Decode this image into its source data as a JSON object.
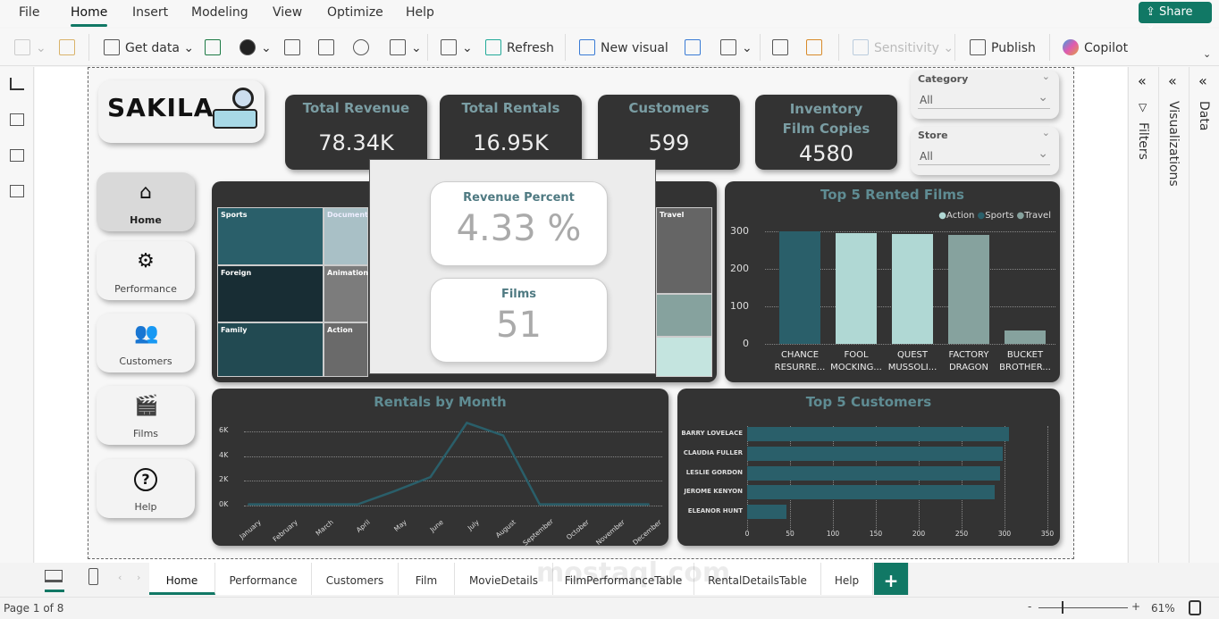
{
  "menu": [
    "File",
    "Home",
    "Insert",
    "Modeling",
    "View",
    "Optimize",
    "Help"
  ],
  "share_label": "Share",
  "ribbon": {
    "get_data": "Get data",
    "refresh": "Refresh",
    "new_visual": "New visual",
    "sensitivity": "Sensitivity",
    "publish": "Publish",
    "copilot": "Copilot"
  },
  "logo_text": "SAKILA",
  "kpis": [
    {
      "title": "Total Revenue",
      "value": "78.34K"
    },
    {
      "title": "Total Rentals",
      "value": "16.95K"
    },
    {
      "title": "Customers",
      "value": "599"
    },
    {
      "title": "Inventory Film Copies",
      "value": "4580"
    }
  ],
  "slicers": [
    {
      "title": "Category",
      "value": "All"
    },
    {
      "title": "Store",
      "value": "All"
    }
  ],
  "nav": [
    {
      "label": "Home",
      "icon": "home-icon"
    },
    {
      "label": "Performance",
      "icon": "performance-icon"
    },
    {
      "label": "Customers",
      "icon": "people-icon"
    },
    {
      "label": "Films",
      "icon": "clapperboard-icon"
    },
    {
      "label": "Help",
      "icon": "question-icon"
    }
  ],
  "treemap": {
    "labels": [
      "Sports",
      "Documentary",
      "Foreign",
      "Animation",
      "Family",
      "Action",
      "Travel"
    ]
  },
  "popup": {
    "cards": [
      {
        "title": "Revenue Percent",
        "value": "4.33 %"
      },
      {
        "title": "Films",
        "value": "51"
      }
    ]
  },
  "panes": {
    "filters": "Filters",
    "visualizations": "Visualizations",
    "data": "Data"
  },
  "tabs": [
    "Home",
    "Performance",
    "Customers",
    "Film",
    "MovieDetails",
    "FilmPerformanceTable",
    "RentalDetailsTable",
    "Help"
  ],
  "status": {
    "page": "Page 1 of 8",
    "zoom": "61%"
  },
  "watermark": "mostaql.com",
  "colors": {
    "accent": "#117865",
    "card": "#333333",
    "sports": "#2a5f6a",
    "action": "#b0d8d4",
    "travel": "#86a29e"
  },
  "chart_data": [
    {
      "type": "bar",
      "title": "Top 5 Rented Films",
      "categories": [
        "CHANCE RESURRE...",
        "FOOL MOCKING...",
        "QUEST MUSSOLI...",
        "FACTORY DRAGON",
        "BUCKET BROTHER..."
      ],
      "values": [
        300,
        296,
        294,
        290,
        35
      ],
      "category_group": [
        "Sports",
        "Action",
        "Action",
        "Travel",
        "Travel"
      ],
      "legend": [
        "Action",
        "Sports",
        "Travel"
      ],
      "legend_position": "top-right",
      "ylim": [
        0,
        300
      ],
      "yticks": [
        0,
        100,
        200,
        300
      ],
      "grid": true
    },
    {
      "type": "line",
      "title": "Rentals by Month",
      "categories": [
        "January",
        "February",
        "March",
        "April",
        "May",
        "June",
        "July",
        "August",
        "September",
        "October",
        "November",
        "December"
      ],
      "values": [
        100,
        100,
        100,
        100,
        1156,
        2311,
        6709,
        5686,
        100,
        100,
        100,
        100
      ],
      "yticks": [
        "0K",
        "2K",
        "4K",
        "6K"
      ],
      "ylim": [
        0,
        6000
      ],
      "grid": true
    },
    {
      "type": "bar",
      "orientation": "horizontal",
      "title": "Top 5 Customers",
      "categories": [
        "BARRY LOVELACE",
        "CLAUDIA FULLER",
        "LESLIE GORDON",
        "JEROME KENYON",
        "ELEANOR HUNT"
      ],
      "values": [
        305,
        298,
        295,
        289,
        46
      ],
      "xticks": [
        0,
        50,
        100,
        150,
        200,
        250,
        300,
        350
      ],
      "xlim": [
        0,
        350
      ],
      "grid": true
    }
  ]
}
